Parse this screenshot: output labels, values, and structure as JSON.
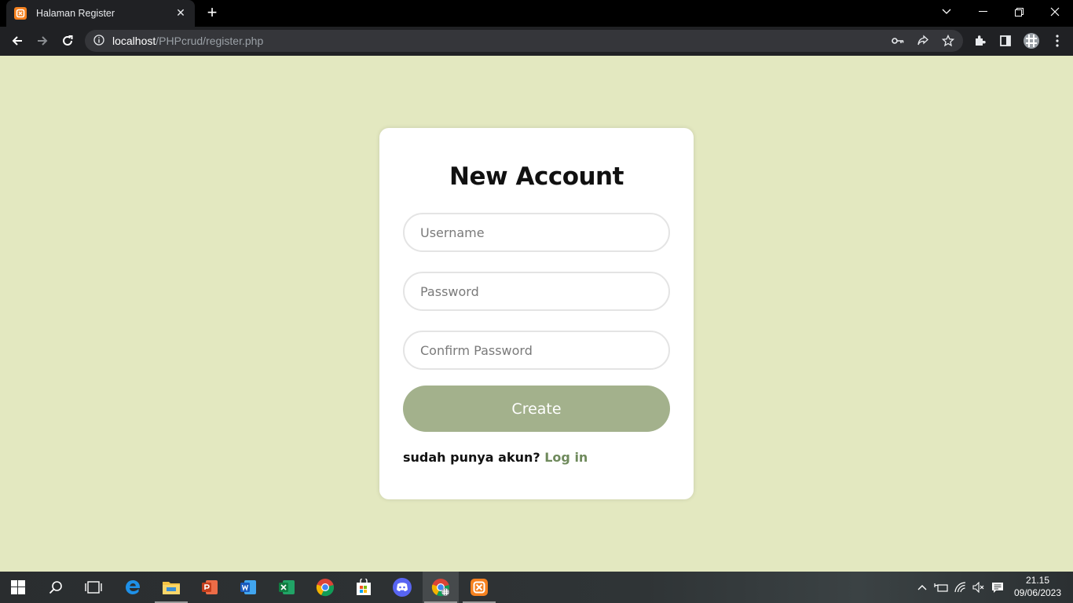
{
  "browser": {
    "tab_title": "Halaman Register",
    "tab_favicon_letter": "ʘ",
    "url_host": "localhost",
    "url_path": "/PHPcrud/register.php"
  },
  "form": {
    "title": "New Account",
    "username_placeholder": "Username",
    "password_placeholder": "Password",
    "confirm_placeholder": "Confirm Password",
    "create_label": "Create",
    "login_prompt": "sudah punya akun?",
    "login_link": "Log in"
  },
  "taskbar": {
    "time": "21.15",
    "date": "09/06/2023",
    "apps": [
      "start-icon",
      "search-icon",
      "task-view-icon",
      "edge-icon",
      "file-explorer-icon",
      "powerpoint-icon",
      "word-icon",
      "excel-icon",
      "chrome-icon",
      "store-icon",
      "discord-icon",
      "chrome-profile-icon",
      "xampp-icon"
    ]
  },
  "colors": {
    "page_bg": "#e3e8c0",
    "button": "#a3b18c",
    "link": "#6f8a5c",
    "favicon": "#f5811f"
  }
}
